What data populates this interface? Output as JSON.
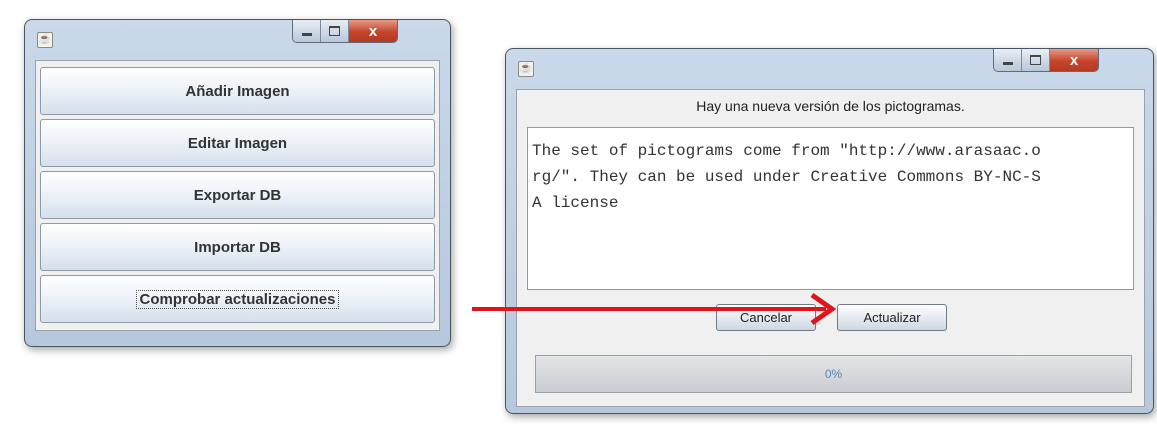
{
  "menu_window": {
    "title_icon": "java-icon",
    "buttons": [
      {
        "label": "Añadir Imagen"
      },
      {
        "label": "Editar Imagen"
      },
      {
        "label": "Exportar DB"
      },
      {
        "label": "Importar DB"
      },
      {
        "label": "Comprobar actualizaciones"
      }
    ]
  },
  "update_dialog": {
    "title_icon": "java-icon",
    "message": "Hay una nueva versión de los pictogramas.",
    "license_text": "The set of pictograms come from \"http://www.arasaac.o\nrg/\". They can be used under Creative Commons BY-NC-S\nA license",
    "cancel_label": "Cancelar",
    "update_label": "Actualizar",
    "progress_label": "0%",
    "progress_value": 0
  },
  "window_controls": {
    "close_glyph": "x"
  },
  "colors": {
    "arrow": "#e0151b",
    "close_button": "#c4452b",
    "progress_text": "#5b84b1"
  }
}
